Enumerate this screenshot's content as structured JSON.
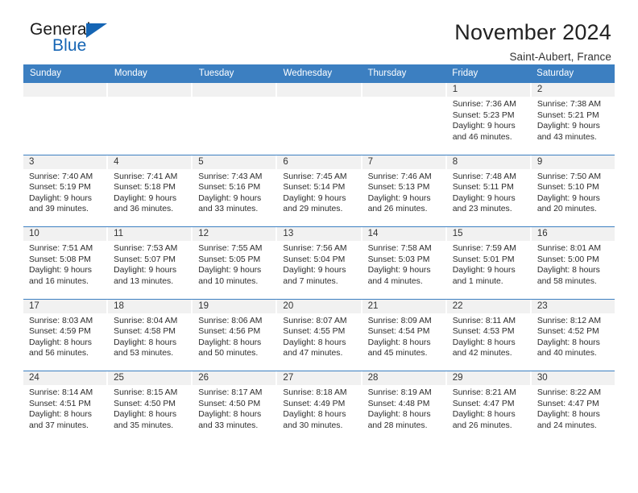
{
  "brand": {
    "name_top": "General",
    "name_bottom": "Blue",
    "accent_color": "#1565b4"
  },
  "header": {
    "title": "November 2024",
    "subtitle": "Saint-Aubert, France"
  },
  "calendar": {
    "header_bg": "#3c7fc1",
    "daynum_bg": "#f1f1f1",
    "weekdays": [
      "Sunday",
      "Monday",
      "Tuesday",
      "Wednesday",
      "Thursday",
      "Friday",
      "Saturday"
    ],
    "weeks": [
      [
        {
          "day": "",
          "sunrise": "",
          "sunset": "",
          "daylight_line1": "",
          "daylight_line2": ""
        },
        {
          "day": "",
          "sunrise": "",
          "sunset": "",
          "daylight_line1": "",
          "daylight_line2": ""
        },
        {
          "day": "",
          "sunrise": "",
          "sunset": "",
          "daylight_line1": "",
          "daylight_line2": ""
        },
        {
          "day": "",
          "sunrise": "",
          "sunset": "",
          "daylight_line1": "",
          "daylight_line2": ""
        },
        {
          "day": "",
          "sunrise": "",
          "sunset": "",
          "daylight_line1": "",
          "daylight_line2": ""
        },
        {
          "day": "1",
          "sunrise": "Sunrise: 7:36 AM",
          "sunset": "Sunset: 5:23 PM",
          "daylight_line1": "Daylight: 9 hours",
          "daylight_line2": "and 46 minutes."
        },
        {
          "day": "2",
          "sunrise": "Sunrise: 7:38 AM",
          "sunset": "Sunset: 5:21 PM",
          "daylight_line1": "Daylight: 9 hours",
          "daylight_line2": "and 43 minutes."
        }
      ],
      [
        {
          "day": "3",
          "sunrise": "Sunrise: 7:40 AM",
          "sunset": "Sunset: 5:19 PM",
          "daylight_line1": "Daylight: 9 hours",
          "daylight_line2": "and 39 minutes."
        },
        {
          "day": "4",
          "sunrise": "Sunrise: 7:41 AM",
          "sunset": "Sunset: 5:18 PM",
          "daylight_line1": "Daylight: 9 hours",
          "daylight_line2": "and 36 minutes."
        },
        {
          "day": "5",
          "sunrise": "Sunrise: 7:43 AM",
          "sunset": "Sunset: 5:16 PM",
          "daylight_line1": "Daylight: 9 hours",
          "daylight_line2": "and 33 minutes."
        },
        {
          "day": "6",
          "sunrise": "Sunrise: 7:45 AM",
          "sunset": "Sunset: 5:14 PM",
          "daylight_line1": "Daylight: 9 hours",
          "daylight_line2": "and 29 minutes."
        },
        {
          "day": "7",
          "sunrise": "Sunrise: 7:46 AM",
          "sunset": "Sunset: 5:13 PM",
          "daylight_line1": "Daylight: 9 hours",
          "daylight_line2": "and 26 minutes."
        },
        {
          "day": "8",
          "sunrise": "Sunrise: 7:48 AM",
          "sunset": "Sunset: 5:11 PM",
          "daylight_line1": "Daylight: 9 hours",
          "daylight_line2": "and 23 minutes."
        },
        {
          "day": "9",
          "sunrise": "Sunrise: 7:50 AM",
          "sunset": "Sunset: 5:10 PM",
          "daylight_line1": "Daylight: 9 hours",
          "daylight_line2": "and 20 minutes."
        }
      ],
      [
        {
          "day": "10",
          "sunrise": "Sunrise: 7:51 AM",
          "sunset": "Sunset: 5:08 PM",
          "daylight_line1": "Daylight: 9 hours",
          "daylight_line2": "and 16 minutes."
        },
        {
          "day": "11",
          "sunrise": "Sunrise: 7:53 AM",
          "sunset": "Sunset: 5:07 PM",
          "daylight_line1": "Daylight: 9 hours",
          "daylight_line2": "and 13 minutes."
        },
        {
          "day": "12",
          "sunrise": "Sunrise: 7:55 AM",
          "sunset": "Sunset: 5:05 PM",
          "daylight_line1": "Daylight: 9 hours",
          "daylight_line2": "and 10 minutes."
        },
        {
          "day": "13",
          "sunrise": "Sunrise: 7:56 AM",
          "sunset": "Sunset: 5:04 PM",
          "daylight_line1": "Daylight: 9 hours",
          "daylight_line2": "and 7 minutes."
        },
        {
          "day": "14",
          "sunrise": "Sunrise: 7:58 AM",
          "sunset": "Sunset: 5:03 PM",
          "daylight_line1": "Daylight: 9 hours",
          "daylight_line2": "and 4 minutes."
        },
        {
          "day": "15",
          "sunrise": "Sunrise: 7:59 AM",
          "sunset": "Sunset: 5:01 PM",
          "daylight_line1": "Daylight: 9 hours",
          "daylight_line2": "and 1 minute."
        },
        {
          "day": "16",
          "sunrise": "Sunrise: 8:01 AM",
          "sunset": "Sunset: 5:00 PM",
          "daylight_line1": "Daylight: 8 hours",
          "daylight_line2": "and 58 minutes."
        }
      ],
      [
        {
          "day": "17",
          "sunrise": "Sunrise: 8:03 AM",
          "sunset": "Sunset: 4:59 PM",
          "daylight_line1": "Daylight: 8 hours",
          "daylight_line2": "and 56 minutes."
        },
        {
          "day": "18",
          "sunrise": "Sunrise: 8:04 AM",
          "sunset": "Sunset: 4:58 PM",
          "daylight_line1": "Daylight: 8 hours",
          "daylight_line2": "and 53 minutes."
        },
        {
          "day": "19",
          "sunrise": "Sunrise: 8:06 AM",
          "sunset": "Sunset: 4:56 PM",
          "daylight_line1": "Daylight: 8 hours",
          "daylight_line2": "and 50 minutes."
        },
        {
          "day": "20",
          "sunrise": "Sunrise: 8:07 AM",
          "sunset": "Sunset: 4:55 PM",
          "daylight_line1": "Daylight: 8 hours",
          "daylight_line2": "and 47 minutes."
        },
        {
          "day": "21",
          "sunrise": "Sunrise: 8:09 AM",
          "sunset": "Sunset: 4:54 PM",
          "daylight_line1": "Daylight: 8 hours",
          "daylight_line2": "and 45 minutes."
        },
        {
          "day": "22",
          "sunrise": "Sunrise: 8:11 AM",
          "sunset": "Sunset: 4:53 PM",
          "daylight_line1": "Daylight: 8 hours",
          "daylight_line2": "and 42 minutes."
        },
        {
          "day": "23",
          "sunrise": "Sunrise: 8:12 AM",
          "sunset": "Sunset: 4:52 PM",
          "daylight_line1": "Daylight: 8 hours",
          "daylight_line2": "and 40 minutes."
        }
      ],
      [
        {
          "day": "24",
          "sunrise": "Sunrise: 8:14 AM",
          "sunset": "Sunset: 4:51 PM",
          "daylight_line1": "Daylight: 8 hours",
          "daylight_line2": "and 37 minutes."
        },
        {
          "day": "25",
          "sunrise": "Sunrise: 8:15 AM",
          "sunset": "Sunset: 4:50 PM",
          "daylight_line1": "Daylight: 8 hours",
          "daylight_line2": "and 35 minutes."
        },
        {
          "day": "26",
          "sunrise": "Sunrise: 8:17 AM",
          "sunset": "Sunset: 4:50 PM",
          "daylight_line1": "Daylight: 8 hours",
          "daylight_line2": "and 33 minutes."
        },
        {
          "day": "27",
          "sunrise": "Sunrise: 8:18 AM",
          "sunset": "Sunset: 4:49 PM",
          "daylight_line1": "Daylight: 8 hours",
          "daylight_line2": "and 30 minutes."
        },
        {
          "day": "28",
          "sunrise": "Sunrise: 8:19 AM",
          "sunset": "Sunset: 4:48 PM",
          "daylight_line1": "Daylight: 8 hours",
          "daylight_line2": "and 28 minutes."
        },
        {
          "day": "29",
          "sunrise": "Sunrise: 8:21 AM",
          "sunset": "Sunset: 4:47 PM",
          "daylight_line1": "Daylight: 8 hours",
          "daylight_line2": "and 26 minutes."
        },
        {
          "day": "30",
          "sunrise": "Sunrise: 8:22 AM",
          "sunset": "Sunset: 4:47 PM",
          "daylight_line1": "Daylight: 8 hours",
          "daylight_line2": "and 24 minutes."
        }
      ]
    ]
  }
}
